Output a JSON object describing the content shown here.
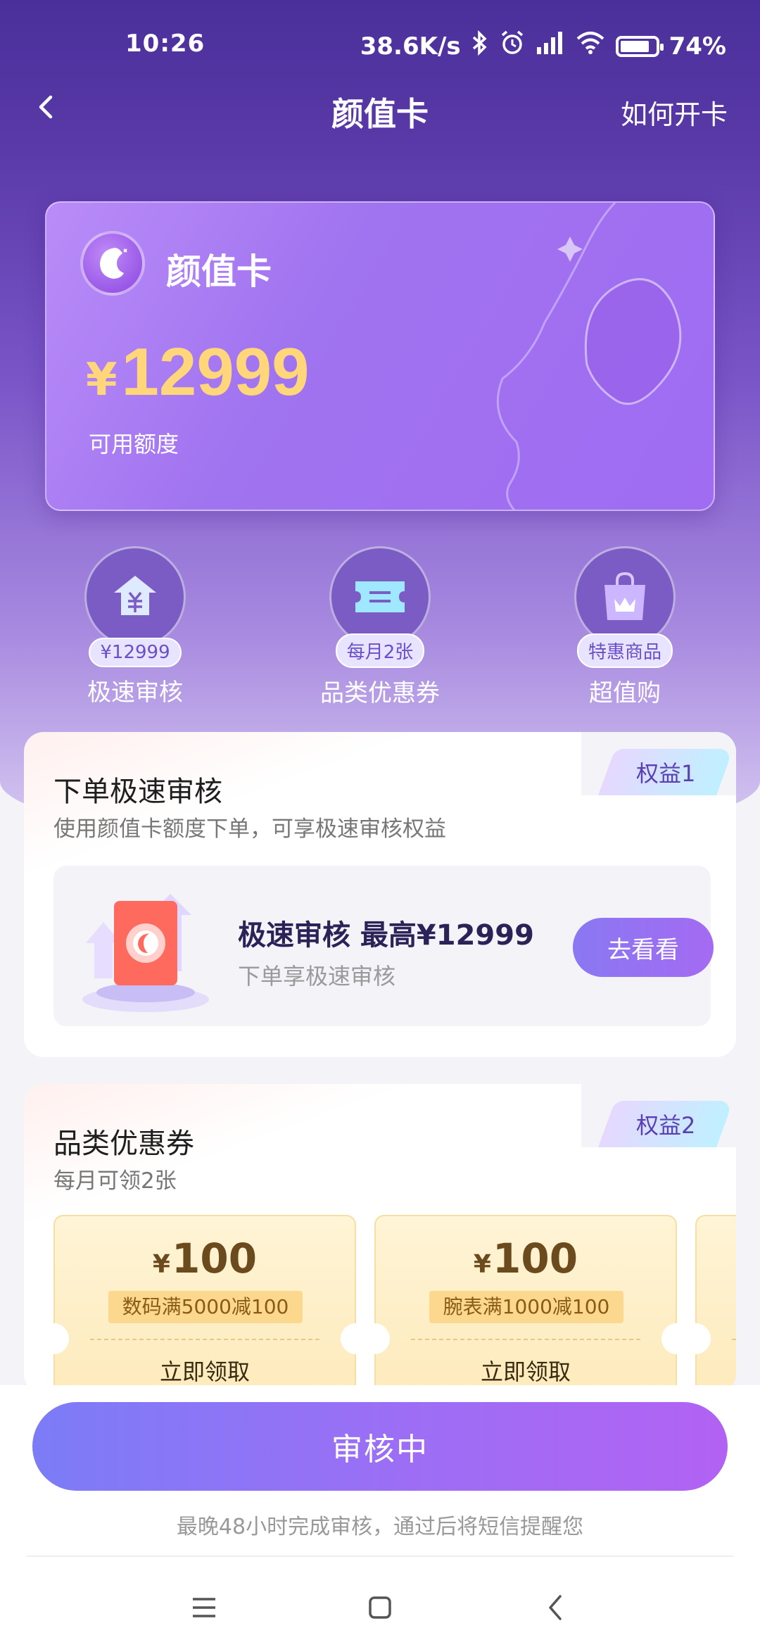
{
  "status_bar": {
    "time": "10:26",
    "network_speed": "38.6K/s",
    "battery": "74%",
    "icons": [
      "bluetooth-icon",
      "alarm-icon",
      "signal-icon",
      "wifi-icon",
      "battery-icon"
    ]
  },
  "nav": {
    "title": "颜值卡",
    "help_label": "如何开卡"
  },
  "card": {
    "title": "颜值卡",
    "currency": "¥",
    "amount": "12999",
    "subtitle": "可用额度"
  },
  "features": [
    {
      "badge": "¥12999",
      "label": "极速审核",
      "icon": "house-money-icon"
    },
    {
      "badge": "每月2张",
      "label": "品类优惠券",
      "icon": "coupon-ticket-icon"
    },
    {
      "badge": "特惠商品",
      "label": "超值购",
      "icon": "shopping-bag-icon"
    }
  ],
  "benefit1": {
    "tag": "权益1",
    "title": "下单极速审核",
    "subtitle": "使用颜值卡额度下单，可享极速审核权益",
    "speed_title": "极速审核 最高¥12999",
    "speed_subtitle": "下单享极速审核",
    "button": "去看看"
  },
  "benefit2": {
    "tag": "权益2",
    "title": "品类优惠券",
    "subtitle": "每月可领2张",
    "coupons": [
      {
        "currency": "¥",
        "amount": "100",
        "condition": "数码满5000减100",
        "claim": "立即领取"
      },
      {
        "currency": "¥",
        "amount": "100",
        "condition": "腕表满1000减100",
        "claim": "立即领取"
      }
    ]
  },
  "bottom": {
    "button": "审核中",
    "note": "最晚48小时完成审核，通过后将短信提醒您"
  },
  "colors": {
    "primary": "#8a6cf2",
    "hero_top": "#4a2f9a",
    "amount_gold": "#ffd77a"
  }
}
